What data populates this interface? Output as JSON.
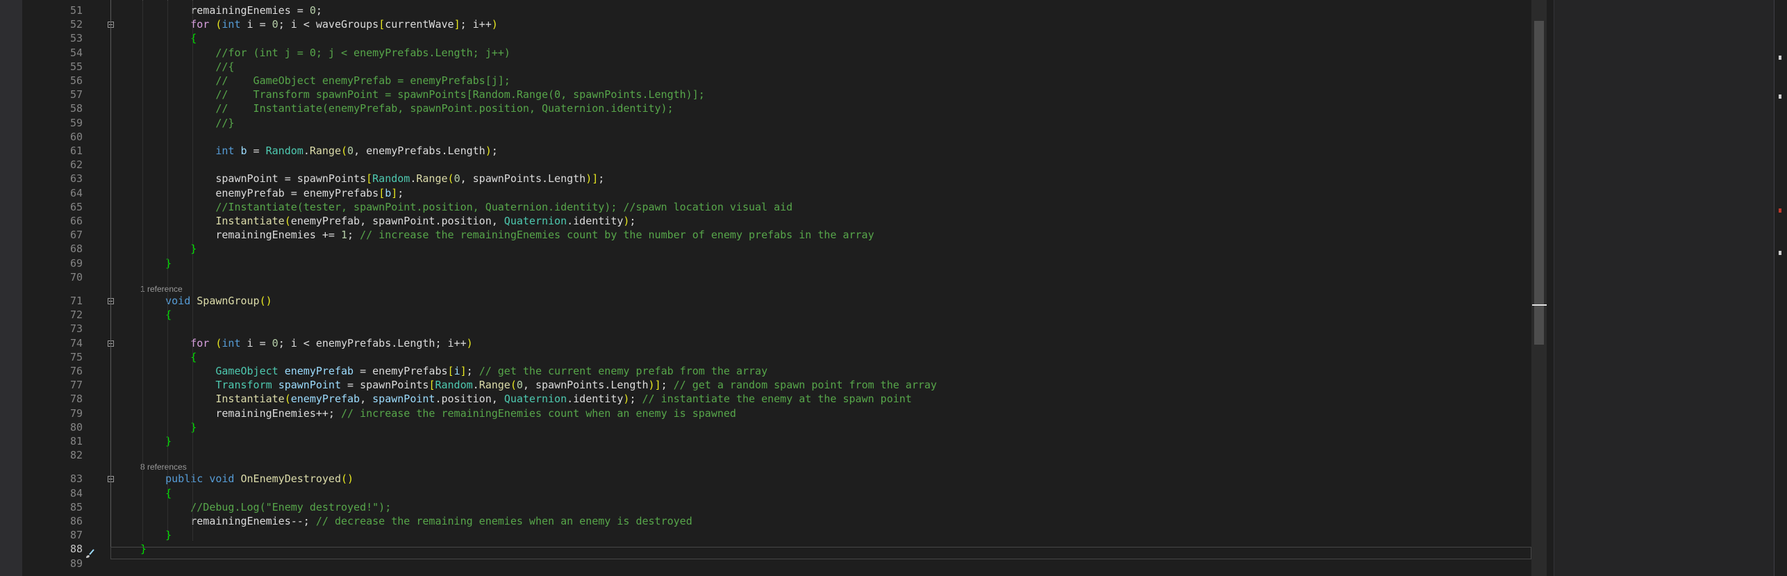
{
  "editor": {
    "lines": [
      {
        "n": "51",
        "tokens": [
          [
            "        ",
            ""
          ],
          [
            "remainingEnemies",
            ""
          ],
          [
            " = ",
            ""
          ],
          [
            "0",
            "num"
          ],
          [
            ";",
            ""
          ]
        ]
      },
      {
        "n": "52",
        "fold": true,
        "tokens": [
          [
            "        ",
            ""
          ],
          [
            "for",
            "kw2"
          ],
          [
            " ",
            ""
          ],
          [
            "(",
            "pn"
          ],
          [
            "int",
            "kw"
          ],
          [
            " i = ",
            ""
          ],
          [
            "0",
            "num"
          ],
          [
            "; i < waveGroups",
            ""
          ],
          [
            "[",
            "pn"
          ],
          [
            "currentWave",
            ""
          ],
          [
            "]",
            "pn"
          ],
          [
            "; i++",
            ""
          ],
          [
            ")",
            "pn"
          ]
        ]
      },
      {
        "n": "53",
        "tokens": [
          [
            "        ",
            ""
          ],
          [
            "{",
            "br"
          ]
        ]
      },
      {
        "n": "54",
        "tokens": [
          [
            "            ",
            ""
          ],
          [
            "//for (int j = 0; j < enemyPrefabs.Length; j++)",
            "cm"
          ]
        ]
      },
      {
        "n": "55",
        "tokens": [
          [
            "            ",
            ""
          ],
          [
            "//{",
            "cm"
          ]
        ]
      },
      {
        "n": "56",
        "tokens": [
          [
            "            ",
            ""
          ],
          [
            "//    GameObject enemyPrefab = enemyPrefabs[j];",
            "cm"
          ]
        ]
      },
      {
        "n": "57",
        "tokens": [
          [
            "            ",
            ""
          ],
          [
            "//    Transform spawnPoint = spawnPoints[Random.Range(0, spawnPoints.Length)];",
            "cm"
          ]
        ]
      },
      {
        "n": "58",
        "tokens": [
          [
            "            ",
            ""
          ],
          [
            "//    Instantiate(enemyPrefab, spawnPoint.position, Quaternion.identity);",
            "cm"
          ]
        ]
      },
      {
        "n": "59",
        "tokens": [
          [
            "            ",
            ""
          ],
          [
            "//}",
            "cm"
          ]
        ]
      },
      {
        "n": "60",
        "tokens": []
      },
      {
        "n": "61",
        "tokens": [
          [
            "            ",
            ""
          ],
          [
            "int",
            "kw"
          ],
          [
            " ",
            ""
          ],
          [
            "b",
            "var"
          ],
          [
            " = ",
            ""
          ],
          [
            "Random",
            "ty"
          ],
          [
            ".",
            ""
          ],
          [
            "Range",
            "fn"
          ],
          [
            "(",
            "pn"
          ],
          [
            "0",
            "num"
          ],
          [
            ", enemyPrefabs.Length",
            ""
          ],
          [
            ")",
            "pn"
          ],
          [
            ";",
            ""
          ]
        ]
      },
      {
        "n": "62",
        "tokens": []
      },
      {
        "n": "63",
        "tokens": [
          [
            "            ",
            ""
          ],
          [
            "spawnPoint = spawnPoints",
            ""
          ],
          [
            "[",
            "pn"
          ],
          [
            "Random",
            "ty"
          ],
          [
            ".",
            ""
          ],
          [
            "Range",
            "fn"
          ],
          [
            "(",
            "pn"
          ],
          [
            "0",
            "num"
          ],
          [
            ", spawnPoints.Length",
            ""
          ],
          [
            ")",
            "pn"
          ],
          [
            "]",
            "pn"
          ],
          [
            ";",
            ""
          ]
        ]
      },
      {
        "n": "64",
        "tokens": [
          [
            "            ",
            ""
          ],
          [
            "enemyPrefab = enemyPrefabs",
            ""
          ],
          [
            "[",
            "pn"
          ],
          [
            "b",
            "var"
          ],
          [
            "]",
            "pn"
          ],
          [
            ";",
            ""
          ]
        ]
      },
      {
        "n": "65",
        "tokens": [
          [
            "            ",
            ""
          ],
          [
            "//Instantiate(tester, spawnPoint.position, Quaternion.identity); //spawn location visual aid",
            "cm"
          ]
        ]
      },
      {
        "n": "66",
        "tokens": [
          [
            "            ",
            ""
          ],
          [
            "Instantiate",
            "fn"
          ],
          [
            "(",
            "pn"
          ],
          [
            "enemyPrefab, spawnPoint.position, ",
            ""
          ],
          [
            "Quaternion",
            "ty"
          ],
          [
            ".identity",
            ""
          ],
          [
            ")",
            "pn"
          ],
          [
            ";",
            ""
          ]
        ]
      },
      {
        "n": "67",
        "tokens": [
          [
            "            ",
            ""
          ],
          [
            "remainingEnemies += ",
            ""
          ],
          [
            "1",
            "num"
          ],
          [
            "; ",
            ""
          ],
          [
            "// increase the remainingEnemies count by the number of enemy prefabs in the array",
            "cm"
          ]
        ]
      },
      {
        "n": "68",
        "tokens": [
          [
            "        ",
            ""
          ],
          [
            "}",
            "br"
          ]
        ]
      },
      {
        "n": "69",
        "tokens": [
          [
            "    ",
            ""
          ],
          [
            "}",
            "br"
          ]
        ]
      },
      {
        "n": "70",
        "tokens": []
      },
      {
        "n": "71",
        "fold": true,
        "ref": "1 reference",
        "tokens": [
          [
            "    ",
            ""
          ],
          [
            "void",
            "kw"
          ],
          [
            " ",
            ""
          ],
          [
            "SpawnGroup",
            "fn"
          ],
          [
            "()",
            "pn"
          ]
        ]
      },
      {
        "n": "72",
        "tokens": [
          [
            "    ",
            ""
          ],
          [
            "{",
            "br"
          ]
        ]
      },
      {
        "n": "73",
        "tokens": []
      },
      {
        "n": "74",
        "fold": true,
        "tokens": [
          [
            "        ",
            ""
          ],
          [
            "for",
            "kw2"
          ],
          [
            " ",
            ""
          ],
          [
            "(",
            "pn"
          ],
          [
            "int",
            "kw"
          ],
          [
            " i = ",
            ""
          ],
          [
            "0",
            "num"
          ],
          [
            "; i < enemyPrefabs.Length; i++",
            ""
          ],
          [
            ")",
            "pn"
          ]
        ]
      },
      {
        "n": "75",
        "tokens": [
          [
            "        ",
            ""
          ],
          [
            "{",
            "br"
          ]
        ]
      },
      {
        "n": "76",
        "tokens": [
          [
            "            ",
            ""
          ],
          [
            "GameObject",
            "ty"
          ],
          [
            " ",
            ""
          ],
          [
            "enemyPrefab",
            "var"
          ],
          [
            " = enemyPrefabs",
            ""
          ],
          [
            "[",
            "pn"
          ],
          [
            "i",
            "var"
          ],
          [
            "]",
            "pn"
          ],
          [
            "; ",
            ""
          ],
          [
            "// get the current enemy prefab from the array",
            "cm"
          ]
        ]
      },
      {
        "n": "77",
        "tokens": [
          [
            "            ",
            ""
          ],
          [
            "Transform",
            "ty"
          ],
          [
            " ",
            ""
          ],
          [
            "spawnPoint",
            "var"
          ],
          [
            " = spawnPoints",
            ""
          ],
          [
            "[",
            "pn"
          ],
          [
            "Random",
            "ty"
          ],
          [
            ".",
            ""
          ],
          [
            "Range",
            "fn"
          ],
          [
            "(",
            "pn"
          ],
          [
            "0",
            "num"
          ],
          [
            ", spawnPoints.Length",
            ""
          ],
          [
            ")",
            "pn"
          ],
          [
            "]",
            "pn"
          ],
          [
            "; ",
            ""
          ],
          [
            "// get a random spawn point from the array",
            "cm"
          ]
        ]
      },
      {
        "n": "78",
        "tokens": [
          [
            "            ",
            ""
          ],
          [
            "Instantiate",
            "fn"
          ],
          [
            "(",
            "pn"
          ],
          [
            "enemyPrefab",
            "var"
          ],
          [
            ", ",
            ""
          ],
          [
            "spawnPoint",
            "var"
          ],
          [
            ".position, ",
            ""
          ],
          [
            "Quaternion",
            "ty"
          ],
          [
            ".identity",
            ""
          ],
          [
            ")",
            "pn"
          ],
          [
            "; ",
            ""
          ],
          [
            "// instantiate the enemy at the spawn point",
            "cm"
          ]
        ]
      },
      {
        "n": "79",
        "tokens": [
          [
            "            ",
            ""
          ],
          [
            "remainingEnemies++; ",
            ""
          ],
          [
            "// increase the remainingEnemies count when an enemy is spawned",
            "cm"
          ]
        ]
      },
      {
        "n": "80",
        "tokens": [
          [
            "        ",
            ""
          ],
          [
            "}",
            "br"
          ]
        ]
      },
      {
        "n": "81",
        "tokens": [
          [
            "    ",
            ""
          ],
          [
            "}",
            "br"
          ]
        ]
      },
      {
        "n": "82",
        "tokens": []
      },
      {
        "n": "83",
        "fold": true,
        "ref": "8 references",
        "tokens": [
          [
            "    ",
            ""
          ],
          [
            "public",
            "kw"
          ],
          [
            " ",
            ""
          ],
          [
            "void",
            "kw"
          ],
          [
            " ",
            ""
          ],
          [
            "OnEnemyDestroyed",
            "fn"
          ],
          [
            "()",
            "pn"
          ]
        ]
      },
      {
        "n": "84",
        "tokens": [
          [
            "    ",
            ""
          ],
          [
            "{",
            "br"
          ]
        ]
      },
      {
        "n": "85",
        "tokens": [
          [
            "        ",
            ""
          ],
          [
            "//Debug.Log(\"Enemy destroyed!\");",
            "cm"
          ]
        ]
      },
      {
        "n": "86",
        "tokens": [
          [
            "        ",
            ""
          ],
          [
            "remainingEnemies--; ",
            ""
          ],
          [
            "// decrease the remaining enemies when an enemy is destroyed",
            "cm"
          ]
        ]
      },
      {
        "n": "87",
        "tokens": [
          [
            "    ",
            ""
          ],
          [
            "}",
            "br"
          ]
        ]
      },
      {
        "n": "88",
        "active": true,
        "tokens": [
          [
            "}",
            "br"
          ]
        ]
      },
      {
        "n": "89",
        "tokens": []
      }
    ]
  },
  "icons": {
    "brush": "paintbrush-icon",
    "fold": "collapse-icon"
  },
  "colors": {
    "background": "#1e1e1e",
    "keyword": "#569cd6",
    "control_keyword": "#d8a0df",
    "type": "#4ec9b0",
    "method": "#dcdcaa",
    "number": "#b5cea8",
    "comment": "#57a64a",
    "local": "#9cdcfe"
  }
}
